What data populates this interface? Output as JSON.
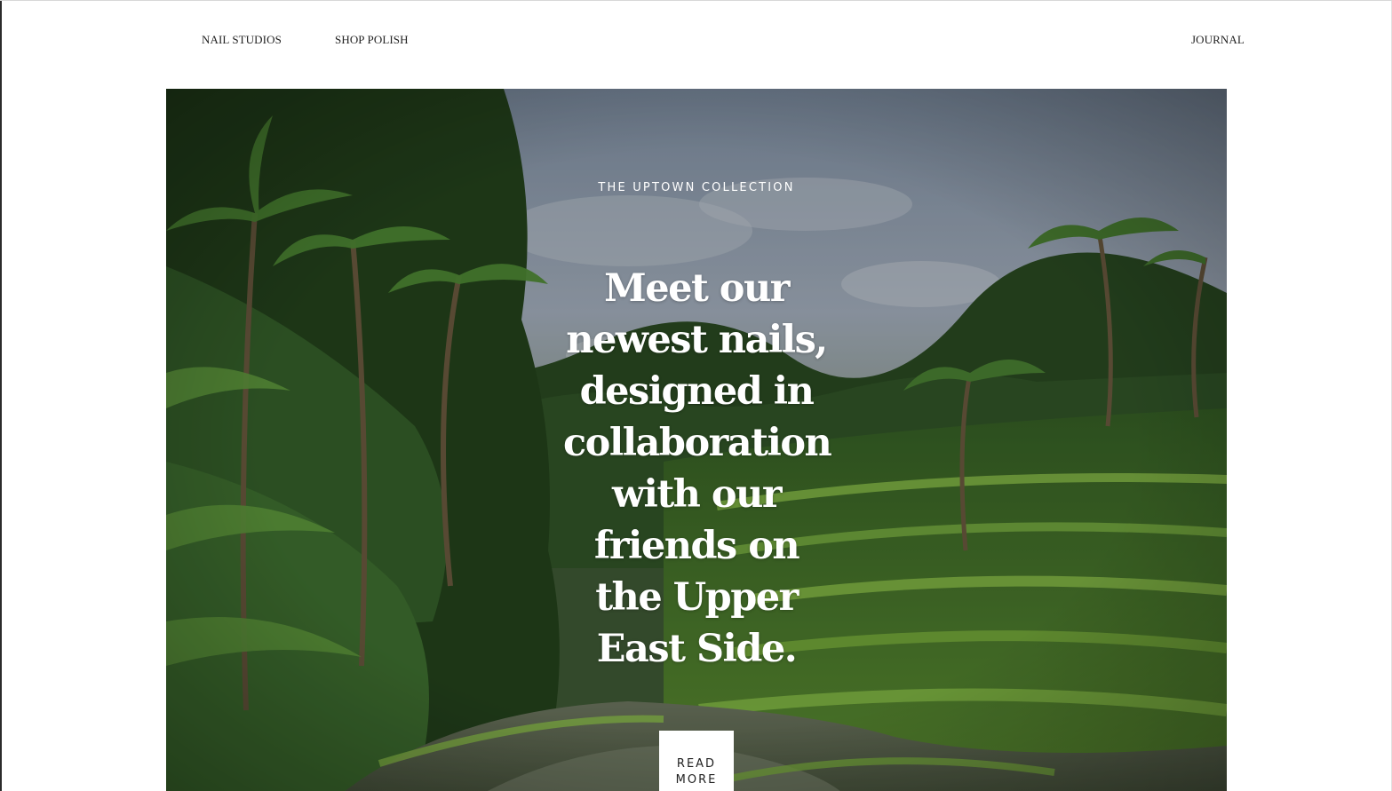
{
  "nav": {
    "items": [
      {
        "label": "NAIL STUDIOS"
      },
      {
        "label": "SHOP POLISH"
      },
      {
        "label": "JOURNAL"
      }
    ]
  },
  "hero": {
    "eyebrow": "THE UPTOWN COLLECTION",
    "headline": "Meet our newest nails, designed in collaboration with our friends on the Upper East Side.",
    "button_label": "READ MORE",
    "image_subject": "jungle rice terraces with palm trees",
    "colors": {
      "sky": "#8a9bb0",
      "foliage_dark": "#1f3a1a",
      "foliage_mid": "#3f6d2b",
      "foliage_light": "#6fa63a",
      "water": "#5e6b4f",
      "text": "#ffffff"
    }
  },
  "colors": {
    "page_background": "#ffffff",
    "nav_text": "#222222",
    "button_background": "#ffffff",
    "button_text": "#222222"
  }
}
